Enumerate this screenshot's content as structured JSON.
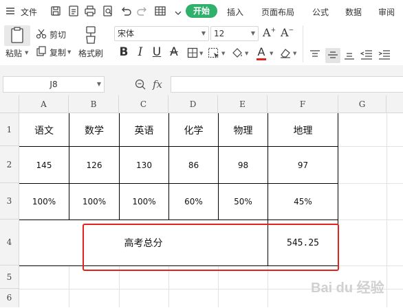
{
  "menubar": {
    "file_label": "文件",
    "tabs": [
      "开始",
      "插入",
      "页面布局",
      "公式",
      "数据",
      "审阅"
    ]
  },
  "ribbon": {
    "paste": "粘贴",
    "cut": "剪切",
    "copy": "复制",
    "format_painter": "格式刷",
    "font_name": "宋体",
    "font_size": "12",
    "bold": "B",
    "italic": "I",
    "underline": "U",
    "strikethrough": "A",
    "font_color_letter": "A",
    "grow_font": "A",
    "shrink_font": "A",
    "font_color": "#e3211c"
  },
  "formula_bar": {
    "name_box": "J8",
    "fx": "fx",
    "formula": ""
  },
  "sheet": {
    "columns": [
      "A",
      "B",
      "C",
      "D",
      "E",
      "F",
      "G"
    ],
    "rows": [
      "1",
      "2",
      "3",
      "4",
      "5",
      "6"
    ],
    "subjects": [
      "语文",
      "数学",
      "英语",
      "化学",
      "物理",
      "地理"
    ],
    "scores": [
      "145",
      "126",
      "130",
      "86",
      "98",
      "97"
    ],
    "percents": [
      "100%",
      "100%",
      "100%",
      "60%",
      "50%",
      "45%"
    ],
    "total_label": "高考总分",
    "total_value": "545.25"
  },
  "watermark": "Bai du 经验",
  "highlight_color": "#e3211c"
}
